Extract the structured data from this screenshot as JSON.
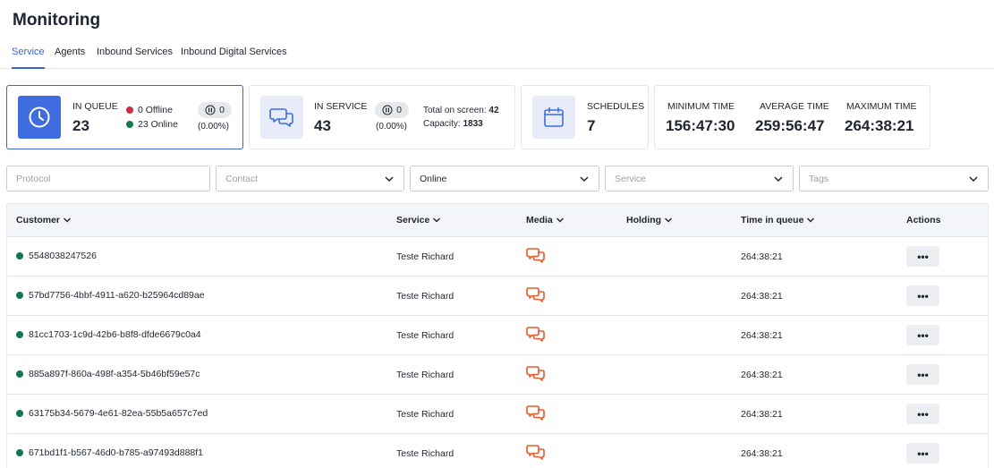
{
  "page": {
    "title": "Monitoring"
  },
  "tabs": [
    {
      "label": "Service",
      "active": true
    },
    {
      "label": "Agents",
      "active": false
    },
    {
      "label": "Inbound Services",
      "active": false
    },
    {
      "label": "Inbound Digital Services",
      "active": false
    }
  ],
  "cards": {
    "in_queue": {
      "label": "IN QUEUE",
      "value": "23",
      "offline": "0 Offline",
      "online": "23 Online",
      "paused": "0",
      "paused_pct": "(0.00%)"
    },
    "in_service": {
      "label": "IN SERVICE",
      "value": "43",
      "paused": "0",
      "paused_pct": "(0.00%)",
      "total_label": "Total on screen:",
      "total_value": "42",
      "capacity_label": "Capacity:",
      "capacity_value": "1833"
    },
    "schedules": {
      "label": "SCHEDULES",
      "value": "7"
    },
    "times": {
      "min_label": "MINIMUM TIME",
      "min_value": "156:47:30",
      "avg_label": "AVERAGE TIME",
      "avg_value": "259:56:47",
      "max_label": "MAXIMUM TIME",
      "max_value": "264:38:21"
    }
  },
  "filters": {
    "protocol": {
      "placeholder": "Protocol"
    },
    "contact": {
      "placeholder": "Contact"
    },
    "status": {
      "value": "Online"
    },
    "service": {
      "placeholder": "Service"
    },
    "tags": {
      "placeholder": "Tags"
    }
  },
  "table": {
    "headers": {
      "customer": "Customer",
      "service": "Service",
      "media": "Media",
      "holding": "Holding",
      "time": "Time in queue",
      "actions": "Actions"
    },
    "rows": [
      {
        "customer": "5548038247526",
        "service": "Teste Richard",
        "time": "264:38:21",
        "action": "•••"
      },
      {
        "customer": "57bd7756-4bbf-4911-a620-b25964cd89ae",
        "service": "Teste Richard",
        "time": "264:38:21",
        "action": "•••"
      },
      {
        "customer": "81cc1703-1c9d-42b6-b8f8-dfde6679c0a4",
        "service": "Teste Richard",
        "time": "264:38:21",
        "action": "•••"
      },
      {
        "customer": "885a897f-860a-498f-a354-5b46bf59e57c",
        "service": "Teste Richard",
        "time": "264:38:21",
        "action": "•••"
      },
      {
        "customer": "63175b34-5679-4e61-82ea-55b5a657c7ed",
        "service": "Teste Richard",
        "time": "264:38:21",
        "action": "•••"
      },
      {
        "customer": "671bd1f1-b567-46d0-b785-a97493d888f1",
        "service": "Teste Richard",
        "time": "264:38:21",
        "action": "•••"
      }
    ]
  },
  "colors": {
    "accent": "#3b63d9",
    "online": "#13794a",
    "offline": "#d0283c",
    "media_icon": "#e8592b"
  },
  "icons": {
    "queue": "clock-icon",
    "service": "chat-bubbles-icon",
    "schedules": "calendar-icon",
    "paused": "pause-circle-icon",
    "media": "chat-bubbles-icon",
    "dropdown": "chevron-down-icon"
  }
}
